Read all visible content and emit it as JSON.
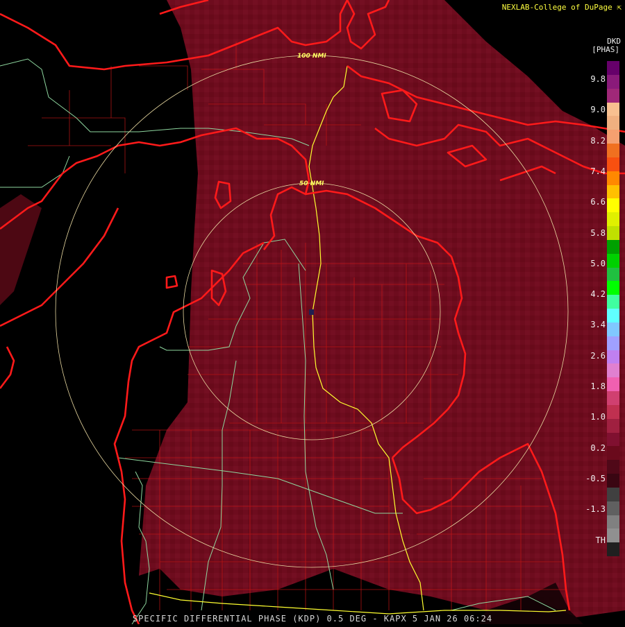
{
  "credit": "NEXLAB-College of DuPage",
  "credit_icon": "corner-arrow-icon",
  "product_code": "DKD",
  "unit_label": "[PHAS]",
  "range_rings": [
    {
      "label": "100 NMI"
    },
    {
      "label": "50 NMI"
    }
  ],
  "colorbar_labels": [
    "9.8",
    "9.0",
    "8.2",
    "7.4",
    "6.6",
    "5.8",
    "5.0",
    "4.2",
    "3.4",
    "2.6",
    "1.8",
    "1.0",
    "0.2",
    "-0.5",
    "-1.3",
    "TH"
  ],
  "footer": "SPECIFIC DIFFERENTIAL PHASE (KDP) 0.5 DEG - KAPX 5 JAN 26 06:24",
  "colors": {
    "echo_base": "#6a0a1c",
    "echo_light": "#7a1222",
    "coast_line": "#ff1a1a",
    "county_line": "#d01818",
    "interstate": "#ffff30",
    "highway": "#8fd8a0",
    "ring": "#e8d8a0"
  },
  "colorbar_colors": [
    "#66006a",
    "#8a1a7a",
    "#a02878",
    "#f8c090",
    "#f0b080",
    "#f5a070",
    "#f07020",
    "#f85010",
    "#ff8800",
    "#ffc000",
    "#ffff00",
    "#e0f000",
    "#c0e000",
    "#00a000",
    "#00d000",
    "#20c040",
    "#00ff00",
    "#40ffa0",
    "#60ffff",
    "#80c8ff",
    "#a0a0ff",
    "#c080f0",
    "#e080d0",
    "#f060b0",
    "#d04070",
    "#c03050",
    "#a02040",
    "#801030",
    "#6a0a1c",
    "#500818",
    "#3a0612",
    "#404040",
    "#606060",
    "#808080",
    "#909090",
    "#202020"
  ]
}
